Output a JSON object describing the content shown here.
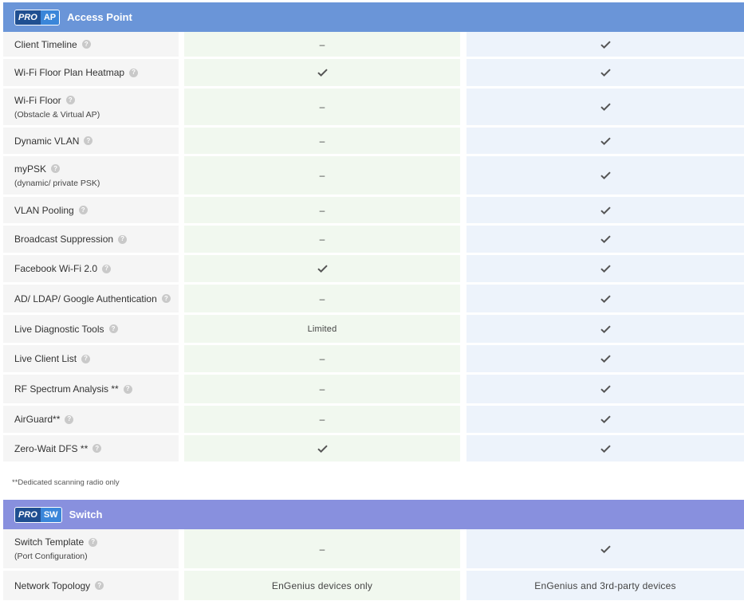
{
  "ap_section": {
    "badge_pro": "PRO",
    "badge_sub": "AP",
    "title": "Access Point",
    "header_color": "#6a95d8",
    "rows": [
      {
        "label": "Client Timeline",
        "sub": "",
        "col_a": "–",
        "col_b": "check",
        "h": 34
      },
      {
        "label": "Wi-Fi Floor Plan Heatmap",
        "sub": "",
        "col_a": "check",
        "col_b": "check",
        "h": 37
      },
      {
        "label": "Wi-Fi Floor",
        "sub": "(Obstacle & Virtual AP)",
        "col_a": "–",
        "col_b": "check",
        "h": 49
      },
      {
        "label": "Dynamic VLAN",
        "sub": "",
        "col_a": "–",
        "col_b": "check",
        "h": 36
      },
      {
        "label": "myPSK",
        "sub": "(dynamic/ private PSK)",
        "col_a": "–",
        "col_b": "check",
        "h": 51
      },
      {
        "label": "VLAN Pooling",
        "sub": "",
        "col_a": "–",
        "col_b": "check",
        "h": 36
      },
      {
        "label": "Broadcast Suppression",
        "sub": "",
        "col_a": "–",
        "col_b": "check",
        "h": 37
      },
      {
        "label": "Facebook Wi-Fi 2.0",
        "sub": "",
        "col_a": "check",
        "col_b": "check",
        "h": 37
      },
      {
        "label": "AD/ LDAP/ Google Authentication",
        "sub": "",
        "col_a": "–",
        "col_b": "check",
        "h": 38
      },
      {
        "label": "Live Diagnostic Tools",
        "sub": "",
        "col_a": "Limited",
        "col_b": "check",
        "h": 38
      },
      {
        "label": "Live Client List",
        "sub": "",
        "col_a": "–",
        "col_b": "check",
        "h": 37
      },
      {
        "label": "RF Spectrum Analysis **",
        "sub": "",
        "col_a": "–",
        "col_b": "check",
        "h": 39
      },
      {
        "label": "AirGuard**",
        "sub": "",
        "col_a": "–",
        "col_b": "check",
        "h": 37
      },
      {
        "label": "Zero-Wait DFS **",
        "sub": "",
        "col_a": "check",
        "col_b": "check",
        "h": 36
      }
    ]
  },
  "footnote": "**Dedicated scanning radio only",
  "sw_section": {
    "badge_pro": "PRO",
    "badge_sub": "SW",
    "title": "Switch",
    "header_color": "#8890de",
    "rows": [
      {
        "label": "Switch Template",
        "sub": "(Port Configuration)",
        "col_a": "–",
        "col_b": "check",
        "h": 52
      },
      {
        "label": "Network Topology",
        "sub": "",
        "col_a": "EnGenius devices only",
        "col_b": "EnGenius and 3rd-party devices",
        "h": 40
      }
    ]
  },
  "icons": {
    "check": "check-icon",
    "help": "help-icon"
  }
}
